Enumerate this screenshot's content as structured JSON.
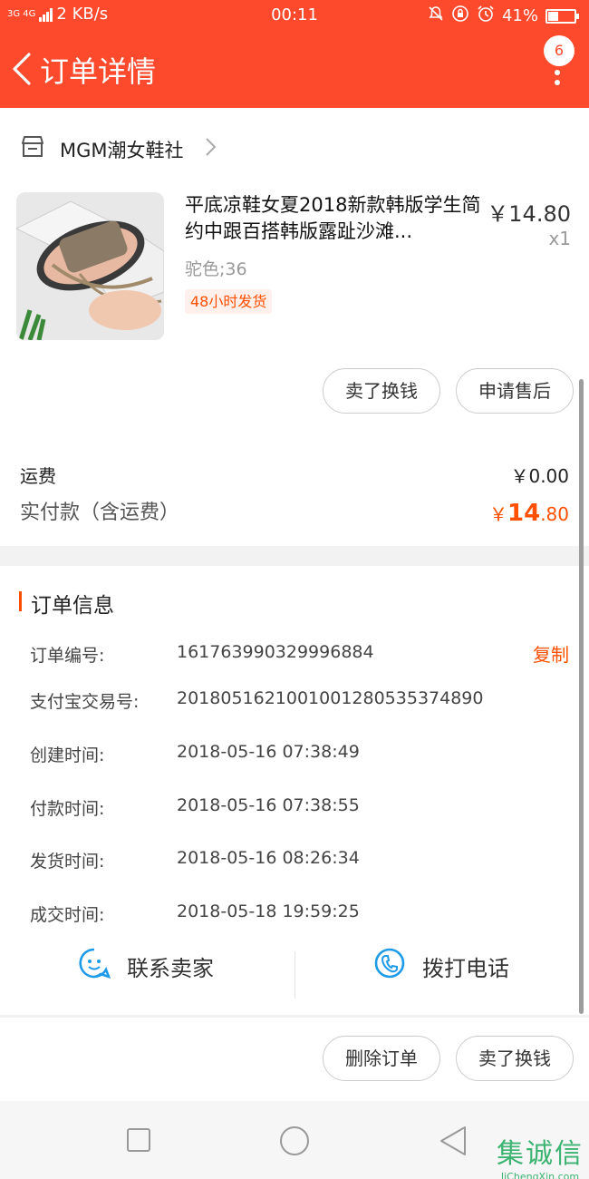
{
  "status_bar": {
    "network": "3G 4G",
    "speed": "2 KB/s",
    "time": "00:11",
    "battery": "41%",
    "battery_level": 0.41
  },
  "nav": {
    "title": "订单详情",
    "badge_count": "6"
  },
  "shop": {
    "name": "MGM潮女鞋社"
  },
  "product": {
    "title": "平底凉鞋女夏2018新款韩版学生简约中跟百搭韩版露趾沙滩...",
    "price": "￥14.80",
    "quantity": "x1",
    "sku": "驼色;36",
    "tag": "48小时发货"
  },
  "product_actions": {
    "sell_label": "卖了换钱",
    "aftersale_label": "申请售后"
  },
  "fees": {
    "shipping_label": "运费",
    "shipping_value": "￥0.00",
    "paid_label": "实付款（含运费）",
    "paid_symbol": "￥",
    "paid_int": "14",
    "paid_dec": ".80"
  },
  "order_info": {
    "title": "订单信息",
    "copy_label": "复制",
    "rows": [
      {
        "label": "订单编号:",
        "value": "161763990329996884"
      },
      {
        "label": "支付宝交易号:",
        "value": "2018051621001001280535374890"
      },
      {
        "label": "创建时间:",
        "value": "2018-05-16 07:38:49"
      },
      {
        "label": "付款时间:",
        "value": "2018-05-16 07:38:55"
      },
      {
        "label": "发货时间:",
        "value": "2018-05-16 08:26:34"
      },
      {
        "label": "成交时间:",
        "value": "2018-05-18 19:59:25"
      }
    ],
    "contact_label": "联系卖家",
    "call_label": "拨打电话"
  },
  "bottom_actions": {
    "delete_label": "删除订单",
    "sell_label": "卖了换钱"
  },
  "watermark": {
    "cn": "集诚信",
    "en": "JiChengXin.com"
  },
  "colors": {
    "brand": "#fe4a2c",
    "accent": "#ff5000",
    "icon_blue": "#1e9be8"
  }
}
